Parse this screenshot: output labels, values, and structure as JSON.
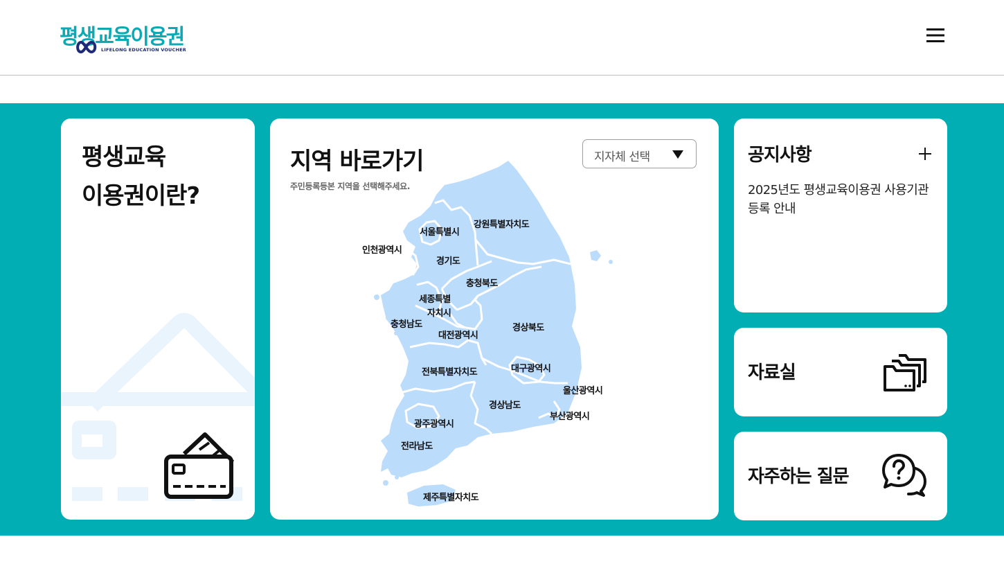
{
  "header": {
    "logo_text": "평생교육이용권",
    "logo_subtext": "LIFELONG EDUCATION VOUCHER",
    "menu_icon": "hamburger-icon"
  },
  "intro_card": {
    "title_line1": "평생교육",
    "title_line2": "이용권이란?",
    "icon": "credit-card-icon"
  },
  "map_card": {
    "title": "지역 바로가기",
    "subtitle": "주민등록등본 지역을 선택해주세요.",
    "select": {
      "selected": "지자체 선택",
      "icon": "caret-down-icon"
    },
    "regions": [
      {
        "name": "서울특별시"
      },
      {
        "name": "강원특별자치도"
      },
      {
        "name": "인천광역시"
      },
      {
        "name": "경기도"
      },
      {
        "name": "충청북도"
      },
      {
        "name": "세종특별"
      },
      {
        "name": "자치시"
      },
      {
        "name": "충청남도"
      },
      {
        "name": "대전광역시"
      },
      {
        "name": "경상북도"
      },
      {
        "name": "대구광역시"
      },
      {
        "name": "전북특별자치도"
      },
      {
        "name": "울산광역시"
      },
      {
        "name": "경상남도"
      },
      {
        "name": "부산광역시"
      },
      {
        "name": "광주광역시"
      },
      {
        "name": "전라남도"
      },
      {
        "name": "제주특별자치도"
      }
    ],
    "colors": {
      "land": "#bcdcfb",
      "border": "#ffffff"
    }
  },
  "notice_card": {
    "title": "공지사항",
    "more_icon": "plus-icon",
    "items": [
      "2025년도 평생교육이용권 사용기관 등록 안내"
    ]
  },
  "data_card": {
    "title": "자료실",
    "icon": "folders-icon"
  },
  "faq_card": {
    "title": "자주하는 질문",
    "icon": "question-chat-icon"
  },
  "colors": {
    "accent": "#00aeb4",
    "brand_navy": "#1e2a78",
    "decor_light": "#eaf4fd"
  }
}
